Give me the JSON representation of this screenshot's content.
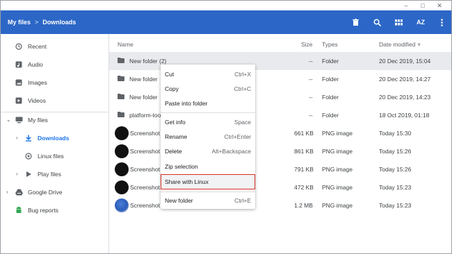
{
  "window": {
    "minimize": "–",
    "maximize": "□",
    "close": "✕"
  },
  "header": {
    "breadcrumb": [
      "My files",
      "Downloads"
    ],
    "separator": ">",
    "icons": [
      "delete-icon",
      "search-icon",
      "grid-view-icon",
      "sort-az-icon",
      "more-icon"
    ],
    "sort_label": "AZ",
    "color": "#2c67c7"
  },
  "sidebar": {
    "items": [
      {
        "label": "Recent",
        "icon": "recent-icon"
      },
      {
        "label": "Audio",
        "icon": "audio-icon"
      },
      {
        "label": "Images",
        "icon": "images-icon"
      },
      {
        "label": "Videos",
        "icon": "videos-icon"
      },
      {
        "label": "My files",
        "icon": "computer-icon"
      },
      {
        "label": "Downloads",
        "icon": "download-icon"
      },
      {
        "label": "Linux files",
        "icon": "linux-icon"
      },
      {
        "label": "Play files",
        "icon": "play-icon"
      },
      {
        "label": "Google Drive",
        "icon": "drive-icon"
      },
      {
        "label": "Bug reports",
        "icon": "android-icon"
      }
    ]
  },
  "columns": {
    "name": "Name",
    "size": "Size",
    "types": "Types",
    "date": "Date modified",
    "sort_arrow": "▾"
  },
  "files": [
    {
      "name": "New folder (2)",
      "size": "--",
      "type": "Folder",
      "date": "20 Dec 2019, 15:04",
      "kind": "folder"
    },
    {
      "name": "New folder",
      "size": "--",
      "type": "Folder",
      "date": "20 Dec 2019, 14:27",
      "kind": "folder"
    },
    {
      "name": "New folder",
      "size": "--",
      "type": "Folder",
      "date": "20 Dec 2019, 14:23",
      "kind": "folder"
    },
    {
      "name": "platform-too",
      "size": "--",
      "type": "Folder",
      "date": "18 Oct 2019, 01:18",
      "kind": "folder"
    },
    {
      "name": "Screenshot",
      "size": "661 KB",
      "type": "PNG image",
      "date": "Today 15:30",
      "kind": "image"
    },
    {
      "name": "Screenshot",
      "size": "861 KB",
      "type": "PNG image",
      "date": "Today 15:26",
      "kind": "image"
    },
    {
      "name": "Screenshot",
      "size": "791 KB",
      "type": "PNG image",
      "date": "Today 15:26",
      "kind": "image"
    },
    {
      "name": "Screenshot",
      "size": "472 KB",
      "type": "PNG image",
      "date": "Today 15:23",
      "kind": "image"
    },
    {
      "name": "Screenshot",
      "size": "1.2 MB",
      "type": "PNG image",
      "date": "Today 15:23",
      "kind": "image-blue"
    }
  ],
  "context_menu": {
    "items": [
      {
        "label": "Cut",
        "shortcut": "Ctrl+X"
      },
      {
        "label": "Copy",
        "shortcut": "Ctrl+C"
      },
      {
        "label": "Paste into folder",
        "shortcut": ""
      },
      {
        "label": "Get info",
        "shortcut": "Space"
      },
      {
        "label": "Rename",
        "shortcut": "Ctrl+Enter"
      },
      {
        "label": "Delete",
        "shortcut": "Alt+Backspace"
      },
      {
        "label": "Zip selection",
        "shortcut": ""
      },
      {
        "label": "Share with Linux",
        "shortcut": ""
      },
      {
        "label": "New folder",
        "shortcut": "Ctrl+E"
      }
    ],
    "highlight_color": "#d93025"
  }
}
